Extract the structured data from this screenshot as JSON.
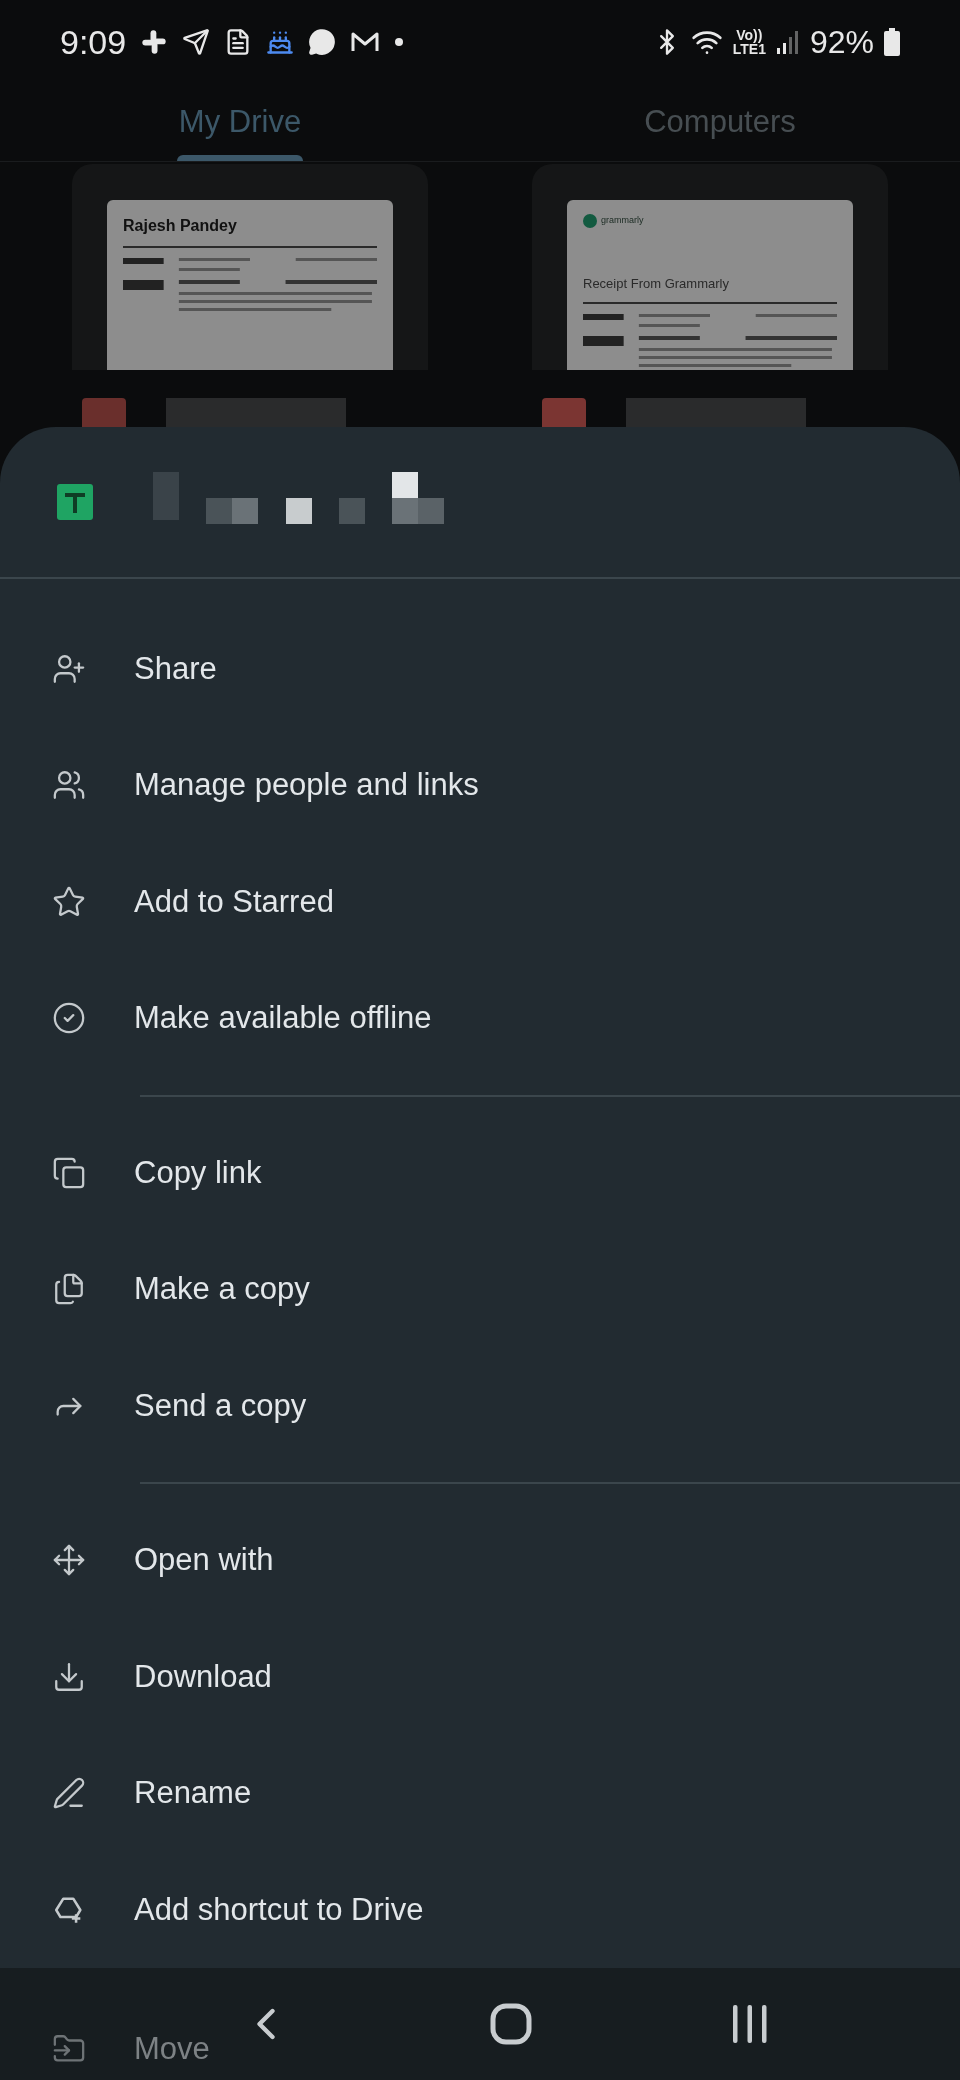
{
  "status_bar": {
    "time": "9:09",
    "network_top": "Vo))",
    "network_bottom": "LTE1",
    "battery": "92%"
  },
  "tabs": [
    {
      "label": "My Drive",
      "selected": true
    },
    {
      "label": "Computers",
      "selected": false
    }
  ],
  "files": [
    {
      "preview_title": "Rajesh Pandey"
    },
    {
      "preview_logo": "grammarly",
      "preview_title": "Receipt From Grammarly"
    }
  ],
  "sheet": {
    "sections": [
      {
        "items": [
          {
            "label": "Share"
          },
          {
            "label": "Manage people and links"
          },
          {
            "label": "Add to Starred"
          },
          {
            "label": "Make available offline"
          }
        ]
      },
      {
        "items": [
          {
            "label": "Copy link"
          },
          {
            "label": "Make a copy"
          },
          {
            "label": "Send a copy"
          }
        ]
      },
      {
        "items": [
          {
            "label": "Open with"
          },
          {
            "label": "Download"
          },
          {
            "label": "Rename"
          },
          {
            "label": "Add shortcut to Drive"
          },
          {
            "label": "Move"
          }
        ]
      }
    ]
  }
}
